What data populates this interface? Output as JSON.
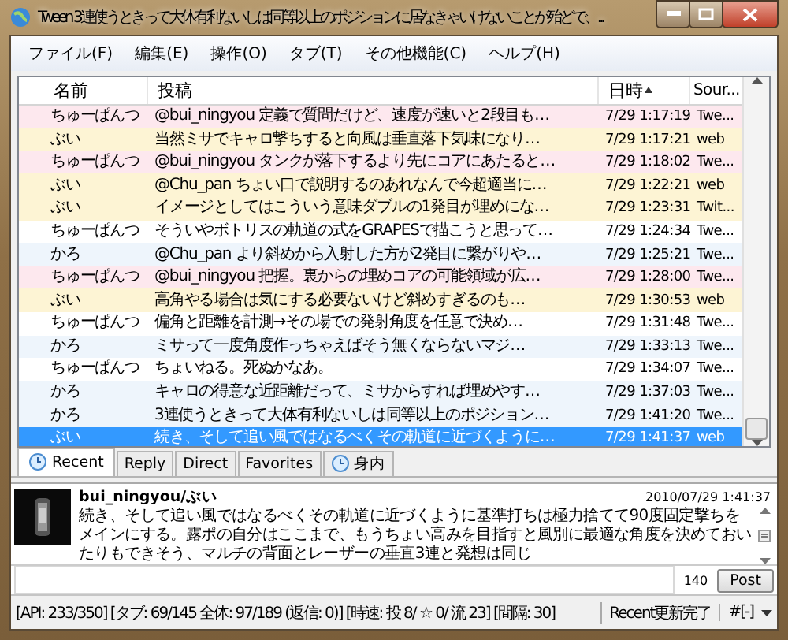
{
  "window": {
    "title": "Tween  3連使うときって大体有利ないしは同等以上のポジションに居なきゃいけないことが殆どで、..."
  },
  "menu": [
    "ファイル(F)",
    "編集(E)",
    "操作(O)",
    "タブ(T)",
    "その他機能(C)",
    "ヘルプ(H)"
  ],
  "table": {
    "columns": [
      {
        "label": "名前",
        "sorted": false
      },
      {
        "label": "投稿",
        "sorted": false
      },
      {
        "label": "日時",
        "sorted": true
      },
      {
        "label": "Sour..."
      }
    ],
    "rows": [
      {
        "name": "ちゅーぱんつ",
        "post": "@bui_ningyou 定義で質問だけど、速度が速いと2段目も…",
        "time": "7/29 1:17:19",
        "source": "Twe...",
        "color": "#fde8ee",
        "selected": false
      },
      {
        "name": "ぶい",
        "post": "当然ミサでキャロ撃ちすると向風は垂直落下気味になり…",
        "time": "7/29 1:17:21",
        "source": "web",
        "color": "#fdf4d4",
        "selected": false
      },
      {
        "name": "ちゅーぱんつ",
        "post": "@bui_ningyou タンクが落下するより先にコアにあたると…",
        "time": "7/29 1:18:02",
        "source": "Twe...",
        "color": "#fde8ee",
        "selected": false
      },
      {
        "name": "ぶい",
        "post": "@Chu_pan ちょい口で説明するのあれなんで今超適当に…",
        "time": "7/29 1:22:21",
        "source": "web",
        "color": "#fdf4d4",
        "selected": false
      },
      {
        "name": "ぶい",
        "post": "イメージとしてはこういう意味ダブルの1発目が埋めにな…",
        "time": "7/29 1:23:31",
        "source": "Twit...",
        "color": "#fdf4d4",
        "selected": false
      },
      {
        "name": "ちゅーぱんつ",
        "post": "そういやボトリスの軌道の式をGRAPESで描こうと思って…",
        "time": "7/29 1:24:34",
        "source": "Twe...",
        "color": "#ffffff",
        "selected": false
      },
      {
        "name": "かろ",
        "post": "@Chu_pan より斜めから入射した方が2発目に繋がりや…",
        "time": "7/29 1:25:21",
        "source": "Twe...",
        "color": "#eef5fc",
        "selected": false
      },
      {
        "name": "ちゅーぱんつ",
        "post": "@bui_ningyou 把握。裏からの埋めコアの可能領域が広…",
        "time": "7/29 1:28:00",
        "source": "Twe...",
        "color": "#fde8ee",
        "selected": false
      },
      {
        "name": "ぶい",
        "post": "高角やる場合は気にする必要ないけど斜めすぎるのも…",
        "time": "7/29 1:30:53",
        "source": "web",
        "color": "#fdf4d4",
        "selected": false
      },
      {
        "name": "ちゅーぱんつ",
        "post": "偏角と距離を計測→その場での発射角度を任意で決め…",
        "time": "7/29 1:31:48",
        "source": "Twe...",
        "color": "#ffffff",
        "selected": false
      },
      {
        "name": "かろ",
        "post": "ミサって一度角度作っちゃえばそう無くならないマジ…",
        "time": "7/29 1:33:13",
        "source": "Twe...",
        "color": "#eef5fc",
        "selected": false
      },
      {
        "name": "ちゅーぱんつ",
        "post": "ちょいねる。死ぬかなあ。",
        "time": "7/29 1:34:07",
        "source": "Twe...",
        "color": "#ffffff",
        "selected": false
      },
      {
        "name": "かろ",
        "post": "キャロの得意な近距離だって、ミサからすれば埋めやす…",
        "time": "7/29 1:37:03",
        "source": "Twe...",
        "color": "#eef5fc",
        "selected": false
      },
      {
        "name": "かろ",
        "post": "3連使うときって大体有利ないしは同等以上のポジション…",
        "time": "7/29 1:41:20",
        "source": "Twe...",
        "color": "#eef5fc",
        "selected": false
      },
      {
        "name": "ぶい",
        "post": "続き、そして追い風ではなるべくその軌道に近づくように…",
        "time": "7/29 1:41:37",
        "source": "web",
        "selected": true
      }
    ]
  },
  "tabs": [
    {
      "label": "Recent",
      "icon": true,
      "selected": true
    },
    {
      "label": "Reply",
      "icon": false,
      "selected": false
    },
    {
      "label": "Direct",
      "icon": false,
      "selected": false
    },
    {
      "label": "Favorites",
      "icon": false,
      "selected": false
    },
    {
      "label": "身内",
      "icon": true,
      "selected": false
    }
  ],
  "detail": {
    "user": "bui_ningyou/ぶい",
    "date": "2010/07/29 1:41:37",
    "text": "続き、そして追い風ではなるべくその軌道に近づくように基準打ちは極力捨てて90度固定撃ちをメインにする。露ポの自分はここまで、もうちょい高みを目指すと風別に最適な角度を決めておいたりもできそう、マルチの背面とレーザーの垂直3連と発想は同じ"
  },
  "compose": {
    "count": "140",
    "button": "Post"
  },
  "status_bar": [
    "[API: 233/350] [タブ: 69/145 全体: 97/189 (返信: 0)] [時速: 投 8/ ☆ 0/ 流 23] [間隔: 30]",
    "Recent更新完了",
    "#[-]"
  ]
}
